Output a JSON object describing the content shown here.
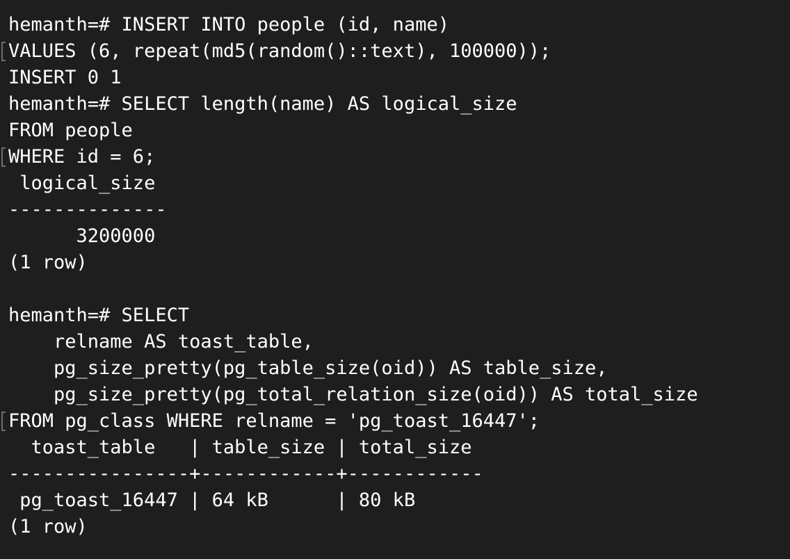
{
  "terminal": {
    "background": "#1e1e1e",
    "foreground": "#ffffff",
    "lines": [
      "hemanth=# INSERT INTO people (id, name)",
      "VALUES (6, repeat(md5(random()::text), 100000));",
      "INSERT 0 1",
      "hemanth=# SELECT length(name) AS logical_size",
      "FROM people",
      "WHERE id = 6;",
      " logical_size",
      "--------------",
      "      3200000",
      "(1 row)",
      "",
      "hemanth=# SELECT",
      "    relname AS toast_table,",
      "    pg_size_pretty(pg_table_size(oid)) AS table_size,",
      "    pg_size_pretty(pg_total_relation_size(oid)) AS total_size",
      "FROM pg_class WHERE relname = 'pg_toast_16447';",
      "  toast_table   | table_size | total_size",
      "----------------+------------+------------",
      " pg_toast_16447 | 64 kB      | 80 kB",
      "(1 row)"
    ]
  }
}
